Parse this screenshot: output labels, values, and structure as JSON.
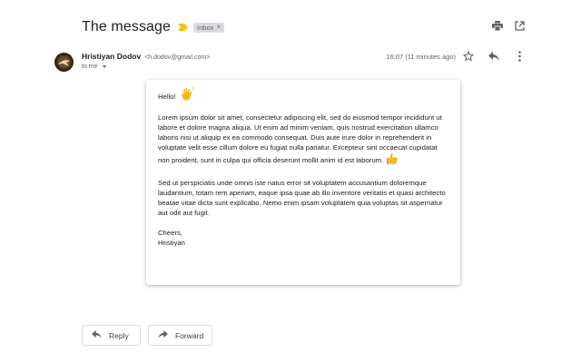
{
  "email": {
    "subject": "The message",
    "label": "Inbox",
    "sender_name": "Hristiyan Dodov",
    "sender_email": "<h.dodov@gmail.com>",
    "recipient": "to me",
    "timestamp": "16:07 (11 minutes ago)",
    "body": {
      "greeting": "Hello!",
      "paragraph1": "Lorem ipsum dolor sit amet, consectetur adipiscing elit, sed do eiusmod tempor incididunt ut labore et dolore magna aliqua. Ut enim ad minim veniam, quis nostrud exercitation ullamco laboris nisi ut aliquip ex ea commodo consequat. Duis aute irure dolor in reprehenderit in voluptate velit esse cillum dolore eu fugiat nulla pariatur. Excepteur sint occaecat cupidatat non proident, sunt in culpa qui officia deserunt mollit anim id est laborum.",
      "paragraph2": "Sed ut perspiciatis unde omnis iste natus error sit voluptatem accusantium doloremque laudantium, totam rem aperiam, eaque ipsa quae ab illo inventore veritatis et quasi architecto beatae vitae dicta sunt explicabo. Nemo enim ipsam voluptatem quia voluptas sit aspernatur aut odit aut fugit.",
      "signoff": "Cheers,",
      "signature": "Hristiyan"
    }
  },
  "actions": {
    "reply_label": "Reply",
    "forward_label": "Forward"
  },
  "icons": {
    "importance": "importance-marker-icon",
    "label_remove": "close-icon",
    "print": "print-icon",
    "open_new_window": "open-in-new-icon",
    "star": "star-icon",
    "reply": "reply-icon",
    "more": "more-vert-icon",
    "wave": "waving-hand-emoji",
    "thumbs_up": "thumbs-up-emoji",
    "forward": "forward-icon"
  },
  "colors": {
    "importance": "#f4c20d",
    "emoji": "#f5b81c",
    "chip_bg": "#dadce0",
    "icon_gray": "#5f6368"
  }
}
